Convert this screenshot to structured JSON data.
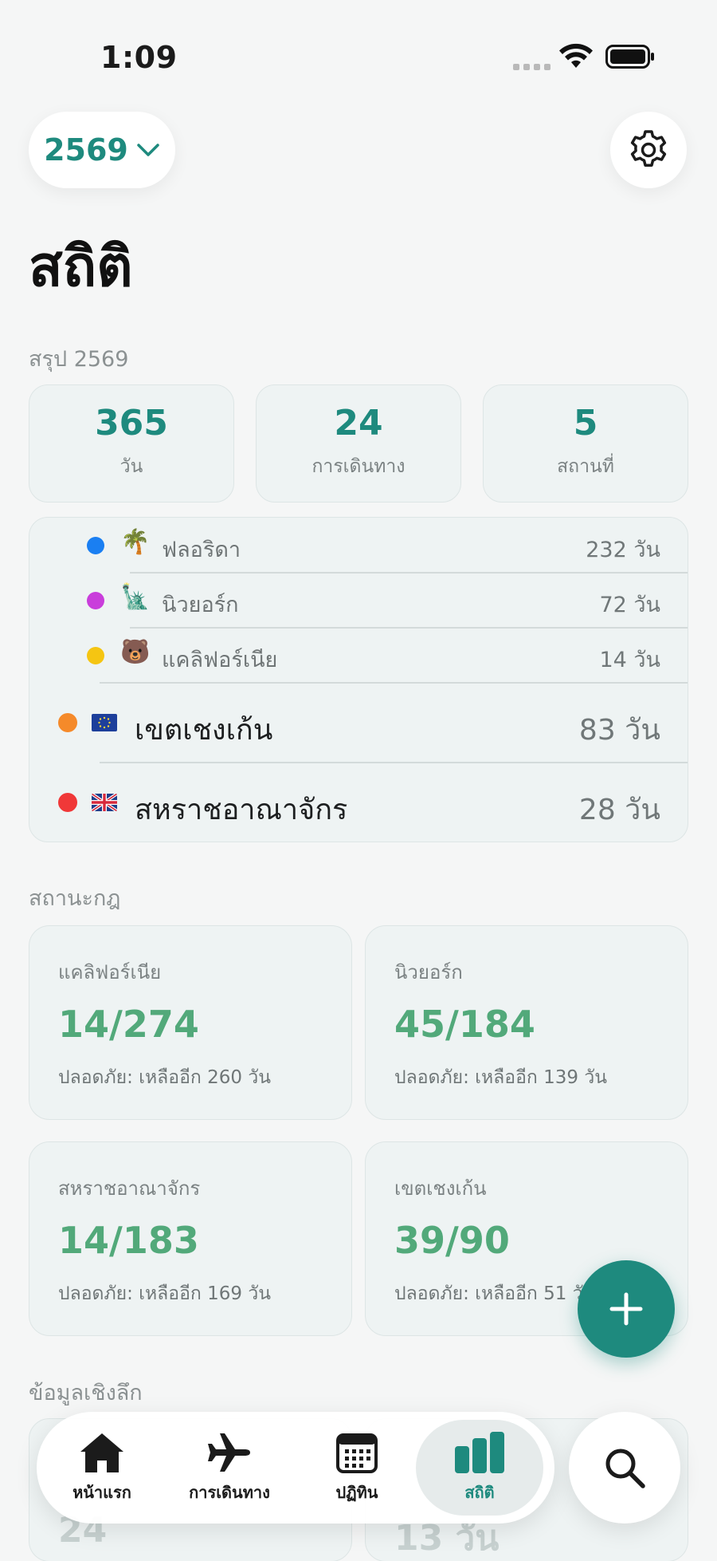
{
  "status_bar": {
    "time": "1:09"
  },
  "header": {
    "year": "2569",
    "title": "สถิติ"
  },
  "summary": {
    "section_label": "สรุป 2569",
    "cards": [
      {
        "value": "365",
        "label": "วัน"
      },
      {
        "value": "24",
        "label": "การเดินทาง"
      },
      {
        "value": "5",
        "label": "สถานที่"
      }
    ]
  },
  "locations": [
    {
      "name": "ฟลอริดา",
      "days": "232 วัน",
      "emoji": "🌴",
      "color": "#1a7ff2"
    },
    {
      "name": "นิวยอร์ก",
      "days": "72 วัน",
      "emoji": "🗽",
      "color": "#c93ddb"
    },
    {
      "name": "แคลิฟอร์เนีย",
      "days": "14 วัน",
      "emoji": "🐻",
      "color": "#f5c512"
    },
    {
      "name": "เขตเชงเก้น",
      "days": "83 วัน",
      "emoji": "eu-flag-icon",
      "color": "#f58a2a"
    },
    {
      "name": "สหราชอาณาจักร",
      "days": "28 วัน",
      "emoji": "uk-flag-icon",
      "color": "#f03838"
    }
  ],
  "limits": {
    "section_label": "สถานะกฎ",
    "cards": [
      {
        "title": "แคลิฟอร์เนีย",
        "value": "14/274",
        "status": "ปลอดภัย: เหลืออีก 260 วัน"
      },
      {
        "title": "นิวยอร์ก",
        "value": "45/184",
        "status": "ปลอดภัย: เหลืออีก 139 วัน"
      },
      {
        "title": "สหราชอาณาจักร",
        "value": "14/183",
        "status": "ปลอดภัย: เหลืออีก 169 วัน"
      },
      {
        "title": "เขตเชงเก้น",
        "value": "39/90",
        "status": "ปลอดภัย: เหลืออีก 51 วัน"
      }
    ]
  },
  "insights": {
    "section_label": "ข้อมูลเชิงลึก",
    "faded_values": [
      "24",
      "13 วัน"
    ]
  },
  "tab_bar": {
    "tabs": [
      {
        "label": "หน้าแรก",
        "icon": "home-icon"
      },
      {
        "label": "การเดินทาง",
        "icon": "airplane-icon"
      },
      {
        "label": "ปฏิทิน",
        "icon": "calendar-icon"
      },
      {
        "label": "สถิติ",
        "icon": "bar-chart-icon",
        "active": true
      }
    ]
  },
  "colors": {
    "accent": "#1e8a7e",
    "safe_green": "#52a97a"
  }
}
